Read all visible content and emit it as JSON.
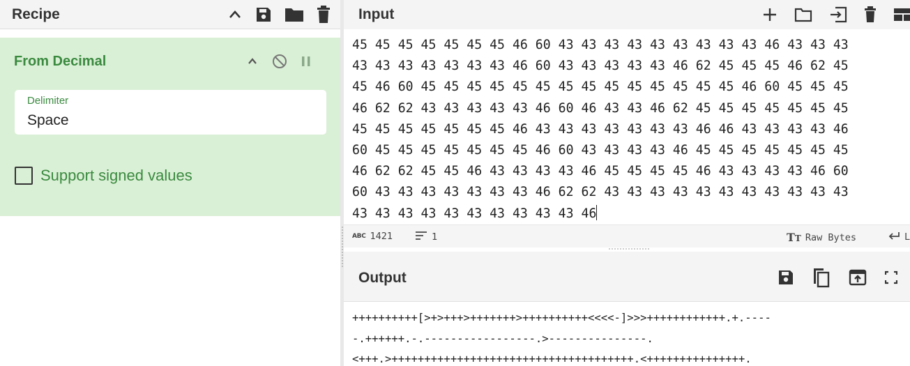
{
  "recipe": {
    "title": "Recipe",
    "header_icons": [
      "chevron-up-icon",
      "save-icon",
      "folder-icon",
      "trash-icon"
    ],
    "operation": {
      "name": "From Decimal",
      "controls": [
        "chevron-up-icon",
        "disable-icon",
        "pause-icon"
      ],
      "delimiter_label": "Delimiter",
      "delimiter_value": "Space",
      "checkbox_label": "Support signed values",
      "checkbox_checked": false
    },
    "colors": {
      "operation_bg": "#daf0d6",
      "operation_text": "#3a8a3f"
    }
  },
  "input": {
    "title": "Input",
    "header_icons": [
      "plus-icon",
      "folder-icon",
      "import-icon",
      "trash-icon",
      "layout-icon"
    ],
    "lines": [
      "45 45 45 45 45 45 45 46 60 43 43 43 43 43 43 43 43 43 46 43 43 43",
      "43 43 43 43 43 43 43 46 60 43 43 43 43 43 46 62 45 45 45 46 62 45",
      "45 46 60 45 45 45 45 45 45 45 45 45 45 45 45 45 45 46 60 45 45 45",
      "46 62 62 43 43 43 43 43 46 60 46 43 43 46 62 45 45 45 45 45 45 45",
      "45 45 45 45 45 45 45 46 43 43 43 43 43 43 43 46 46 43 43 43 43 46",
      "60 45 45 45 45 45 45 45 46 60 43 43 43 43 46 45 45 45 45 45 45 45",
      "46 62 62 45 45 46 43 43 43 43 46 45 45 45 45 46 43 43 43 43 46 60",
      "60 43 43 43 43 43 43 43 46 62 62 43 43 43 43 43 43 43 43 43 43 43",
      "43 43 43 43 43 43 43 43 43 43 46"
    ],
    "status": {
      "abc_icon": "ABC",
      "char_count": "1421",
      "line_count": "1",
      "encoding": "Raw Bytes",
      "eol_partial": "L"
    }
  },
  "output": {
    "title": "Output",
    "header_icons": [
      "save-icon",
      "copy-icon",
      "replace-input-icon",
      "maximize-icon"
    ],
    "lines": [
      "++++++++++[>+>+++>+++++++>++++++++++<<<<-]>>>++++++++++++.+.----",
      "-.++++++.-.-----------------.>---------------.",
      "<+++.>+++++++++++++++++++++++++++++++++++++.<+++++++++++++++."
    ]
  }
}
